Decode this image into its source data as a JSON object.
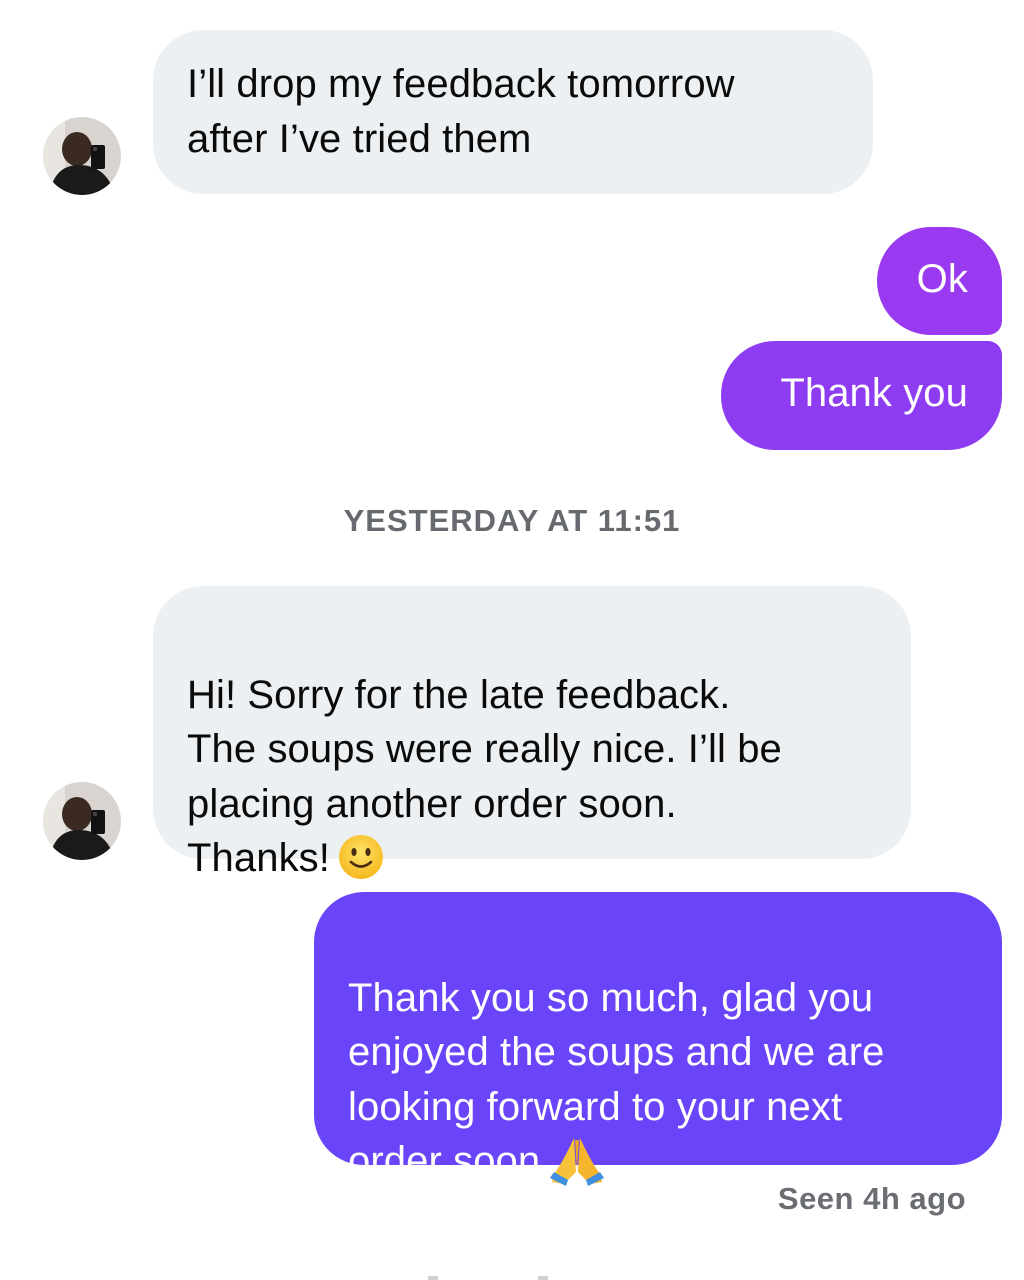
{
  "conversation": {
    "messages": [
      {
        "from": "contact",
        "text": "I’ll drop my feedback tomorrow\nafter I’ve tried them"
      },
      {
        "from": "me",
        "text": "Ok"
      },
      {
        "from": "me",
        "text": "Thank you"
      },
      {
        "from": "contact",
        "text": "Hi! Sorry for the late feedback.\nThe soups were really nice. I’ll be\nplacing another order soon.\nThanks!",
        "emoji": "slightly-smiling-face-icon"
      },
      {
        "from": "me",
        "text": "Thank you so much, glad you\nenjoyed the soups and we are\nlooking forward to your next\norder soon",
        "emoji": "folded-hands-icon"
      }
    ],
    "timestamp": "YESTERDAY AT 11:51",
    "seen_status": "Seen 4h ago"
  },
  "colors": {
    "incoming_bubble": "#edf0f2",
    "outgoing_bubble_top": "#9a3af0",
    "outgoing_bubble_mid": "#8e3cf2",
    "outgoing_bubble_bottom": "#6a44f8",
    "meta_text": "#66696d"
  }
}
